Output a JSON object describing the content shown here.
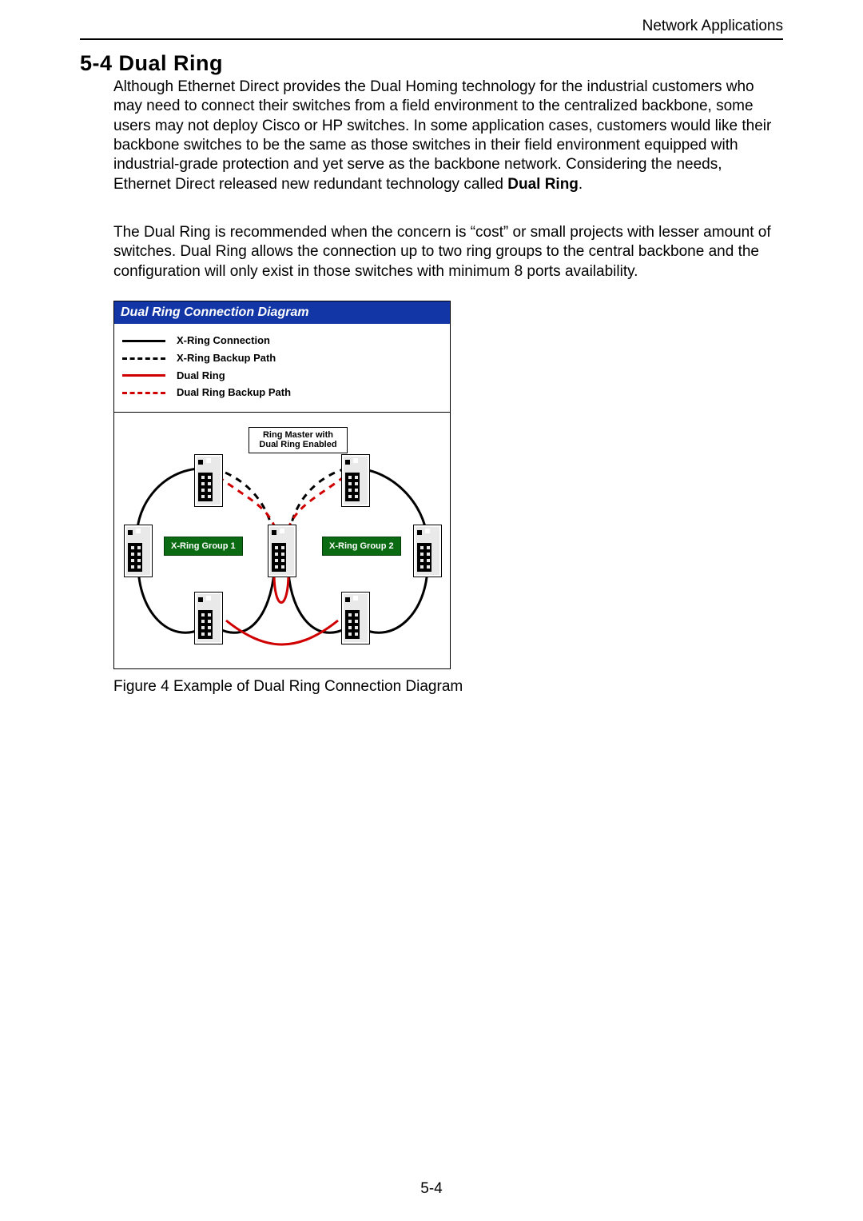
{
  "header": {
    "running": "Network  Applications"
  },
  "section": {
    "number": "5-4",
    "title": "Dual Ring",
    "p1a": "Although Ethernet Direct provides the Dual Homing technology for the industrial customers who may need to connect their switches from a field environment to the centralized backbone, some users may not deploy Cisco or HP switches. In some application cases, customers would like their backbone switches to be the same as those switches in their field environment equipped with industrial-grade protection and yet serve as the backbone network. Considering the needs, Ethernet Direct released new redundant technology called ",
    "p1b": "Dual Ring",
    "p1c": ".",
    "p2": "The Dual Ring is recommended when the concern is “cost” or small projects with lesser amount of switches. Dual Ring allows the connection up to two ring groups to the central backbone and the configuration will only exist in those switches with minimum 8 ports availability."
  },
  "figure": {
    "title": "Dual Ring Connection Diagram",
    "legend": {
      "xring": "X-Ring Connection",
      "xring_backup": "X-Ring Backup Path",
      "dualring": "Dual Ring",
      "dualring_backup": "Dual Ring Backup Path"
    },
    "master_label_l1": "Ring Master with",
    "master_label_l2": "Dual Ring Enabled",
    "group1": "X-Ring Group 1",
    "group2": "X-Ring Group 2",
    "caption": "Figure 4 Example of Dual Ring Connection Diagram"
  },
  "page_number": "5-4"
}
